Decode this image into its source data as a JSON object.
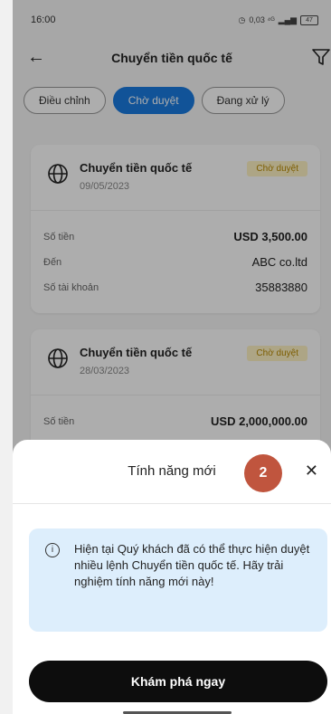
{
  "status_bar": {
    "time": "16:00",
    "icons_text": "0,03 ⁴ᴳ",
    "battery": "47"
  },
  "header": {
    "title": "Chuyển tiền quốc tế"
  },
  "tabs": [
    {
      "label": "Điều chỉnh"
    },
    {
      "label": "Chờ duyệt"
    },
    {
      "label": "Đang xử lý"
    }
  ],
  "cards": [
    {
      "title": "Chuyển tiền quốc tế",
      "date": "09/05/2023",
      "status": "Chờ duyệt",
      "rows": [
        {
          "label": "Số tiền",
          "value": "USD 3,500.00"
        },
        {
          "label": "Đến",
          "value": "ABC co.ltd"
        },
        {
          "label": "Số tài khoản",
          "value": "35883880"
        }
      ]
    },
    {
      "title": "Chuyển tiền quốc tế",
      "date": "28/03/2023",
      "status": "Chờ duyệt",
      "rows": [
        {
          "label": "Số tiền",
          "value": "USD 2,000,000.00"
        }
      ]
    }
  ],
  "sheet": {
    "title": "Tính năng mới",
    "info": "Hiện tại Quý khách đã có thể thực hiện duyệt nhiều lệnh Chuyển tiền quốc tế. Hãy trải nghiệm tính năng mới này!",
    "button": "Khám phá ngay"
  },
  "step_marker": "2",
  "colors": {
    "accent": "#1a7be0",
    "badge_bg": "#fff3c4",
    "info_bg": "#ddeefc",
    "marker": "#c0553e",
    "button": "#0d0d0d"
  }
}
